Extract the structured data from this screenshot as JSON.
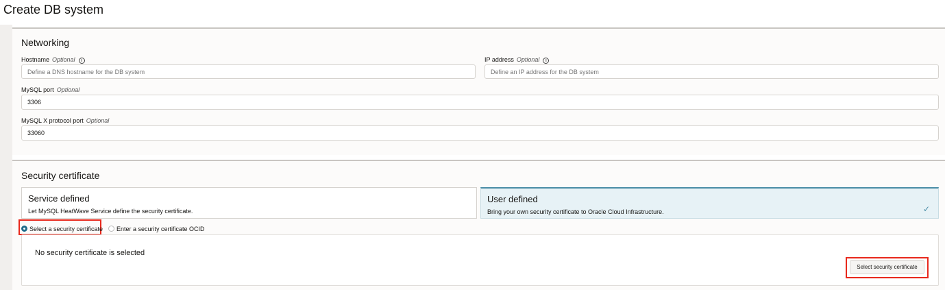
{
  "page_title": "Create DB system",
  "networking": {
    "heading": "Networking",
    "hostname": {
      "label": "Hostname",
      "optional": "Optional",
      "placeholder": "Define a DNS hostname for the DB system",
      "info_icon": "i"
    },
    "ip_address": {
      "label": "IP address",
      "optional": "Optional",
      "placeholder": "Define an IP address for the DB system",
      "info_icon": "i"
    },
    "mysql_port": {
      "label": "MySQL port",
      "optional": "Optional",
      "value": "3306"
    },
    "x_protocol_port": {
      "label": "MySQL X protocol port",
      "optional": "Optional",
      "value": "33060"
    }
  },
  "security": {
    "heading": "Security certificate",
    "cards": [
      {
        "title": "Service defined",
        "desc": "Let MySQL HeatWave Service define the security certificate.",
        "selected": false
      },
      {
        "title": "User defined",
        "desc": "Bring your own security certificate to Oracle Cloud Infrastructure.",
        "selected": true,
        "check": "✓"
      }
    ],
    "radios": [
      {
        "label": "Select a security certificate",
        "checked": true
      },
      {
        "label": "Enter a security certificate OCID",
        "checked": false
      }
    ],
    "empty_text": "No security certificate is selected",
    "select_button": "Select security certificate"
  },
  "colors": {
    "accent": "#1f6b8a",
    "highlight": "#e8281c",
    "selected_card": "#e7f2f6"
  }
}
